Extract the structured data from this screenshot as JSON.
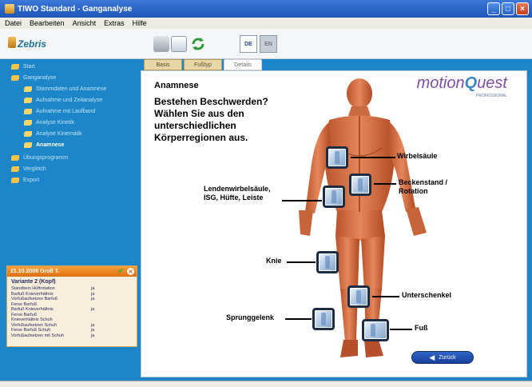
{
  "window": {
    "title": "TIWO Standard - Ganganalyse"
  },
  "menu": [
    "Datei",
    "Bearbeiten",
    "Ansicht",
    "Extras",
    "Hilfe"
  ],
  "toolbar": {
    "logo": "Zebris",
    "lang_de": "DE",
    "lang_other": "EN"
  },
  "sidebar": {
    "items": [
      {
        "label": "Start",
        "level": 0
      },
      {
        "label": "Ganganalyse",
        "level": 0
      },
      {
        "label": "Stammdaten und Anamnese",
        "level": 1
      },
      {
        "label": "Aufnahme und Zeitanalyse",
        "level": 1
      },
      {
        "label": "Aufnahme mit Laufband",
        "level": 1
      },
      {
        "label": "Analyse Kinetik",
        "level": 1
      },
      {
        "label": "Analyse Kinematik",
        "level": 1
      },
      {
        "label": "Anamnese",
        "level": 1,
        "active": true
      },
      {
        "label": "Übungsprogramm",
        "level": 0
      },
      {
        "label": "Vergleich",
        "level": 0
      },
      {
        "label": "Export",
        "level": 0
      }
    ]
  },
  "patient": {
    "header": "21.10.2008 Groß T.",
    "subtitle": "Variante 2 (Kopf)",
    "rows": [
      {
        "k": "Standbein Hüftrotation",
        "v": "ja"
      },
      {
        "k": "Barfuß Knieverhältnis",
        "v": "ja"
      },
      {
        "k": "Vorfußaufsetzen Barfuß",
        "v": "ja"
      },
      {
        "k": "Ferse Barfuß",
        "v": ""
      },
      {
        "k": "Barfuß Knieverhältnis",
        "v": "ja"
      },
      {
        "k": "Ferse Barfuß",
        "v": ""
      },
      {
        "k": "Knieverhältnis Schuh",
        "v": ""
      },
      {
        "k": "Vorfußaufsetzen Schuh",
        "v": "ja"
      },
      {
        "k": "Ferse Barfuß Schuh",
        "v": "ja"
      },
      {
        "k": "Vorfußaufsetzen mit Schuh",
        "v": "ja"
      }
    ]
  },
  "tabs": [
    "Basis",
    "Fußtyp",
    "Details"
  ],
  "content": {
    "title": "Anamnese",
    "prompt": "Bestehen Beschwerden? Wählen Sie aus den unterschiedlichen Körperregionen aus.",
    "brand_main": "motion",
    "brand_q": "Q",
    "brand_rest": "uest",
    "brand_sub": "PROFESSIONAL",
    "regions": {
      "wirbelsaeule": "Wirbelsäule",
      "becken": "Beckenstand / Rotation",
      "lende": "Lendenwirbelsäule, ISG, Hüfte, Leiste",
      "knie": "Knie",
      "unterschenkel": "Unterschenkel",
      "sprunggelenk": "Sprunggelenk",
      "fuss": "Fuß"
    },
    "back_label": "Zurück"
  }
}
